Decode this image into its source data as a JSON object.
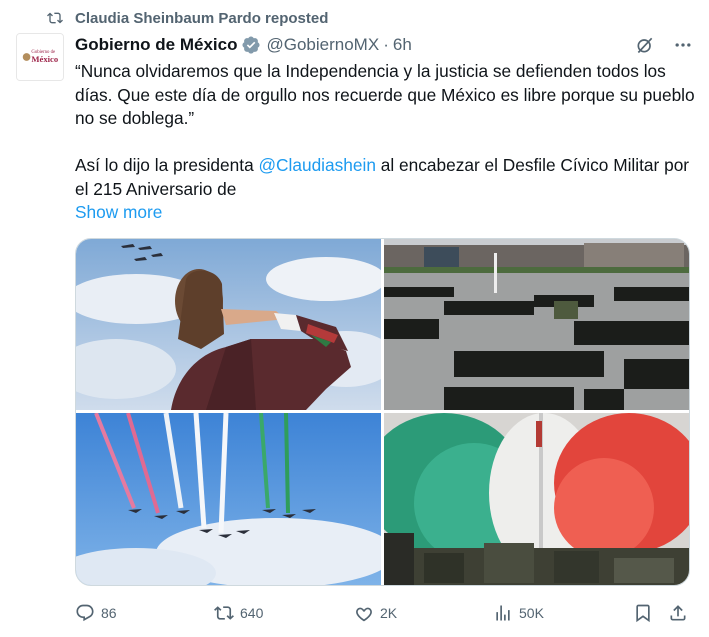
{
  "repost": {
    "label": "Claudia Sheinbaum Pardo reposted",
    "icon": "repost-icon"
  },
  "author": {
    "avatar_label": "Gobierno de México",
    "name": "Gobierno de México",
    "handle": "@GobiernoMX",
    "separator": "·",
    "time": "6h",
    "verified_color": "#829aab"
  },
  "tweet": {
    "line1": "“Nunca olvidaremos que la Independencia y la justicia se defienden todos los días. Que este día de orgullo nos recuerde que México es libre porque su pueblo no se doblega.”",
    "line2_prefix": "Así lo dijo la presidenta ",
    "mention": "@Claudiashein",
    "line2_suffix": " al encabezar el Desfile Cívico Militar por el 215 Aniversario de",
    "show_more": "Show more"
  },
  "media": [
    {
      "name": "photo-salute",
      "alt": "President saluting with aircraft overhead"
    },
    {
      "name": "photo-zocalo-parade",
      "alt": "Military formation in the Zócalo"
    },
    {
      "name": "photo-aircraft-smoke",
      "alt": "Aircraft trailing colored smoke"
    },
    {
      "name": "photo-tricolor-smoke",
      "alt": "Green white and red smoke over vehicles"
    }
  ],
  "actions": {
    "replies": "86",
    "reposts": "640",
    "likes": "2K",
    "views": "50K"
  },
  "colors": {
    "accent": "#1d9bf0",
    "muted": "#536471",
    "text": "#0f1419",
    "gob_red": "#9d2449",
    "gob_gold": "#b38e5d"
  }
}
